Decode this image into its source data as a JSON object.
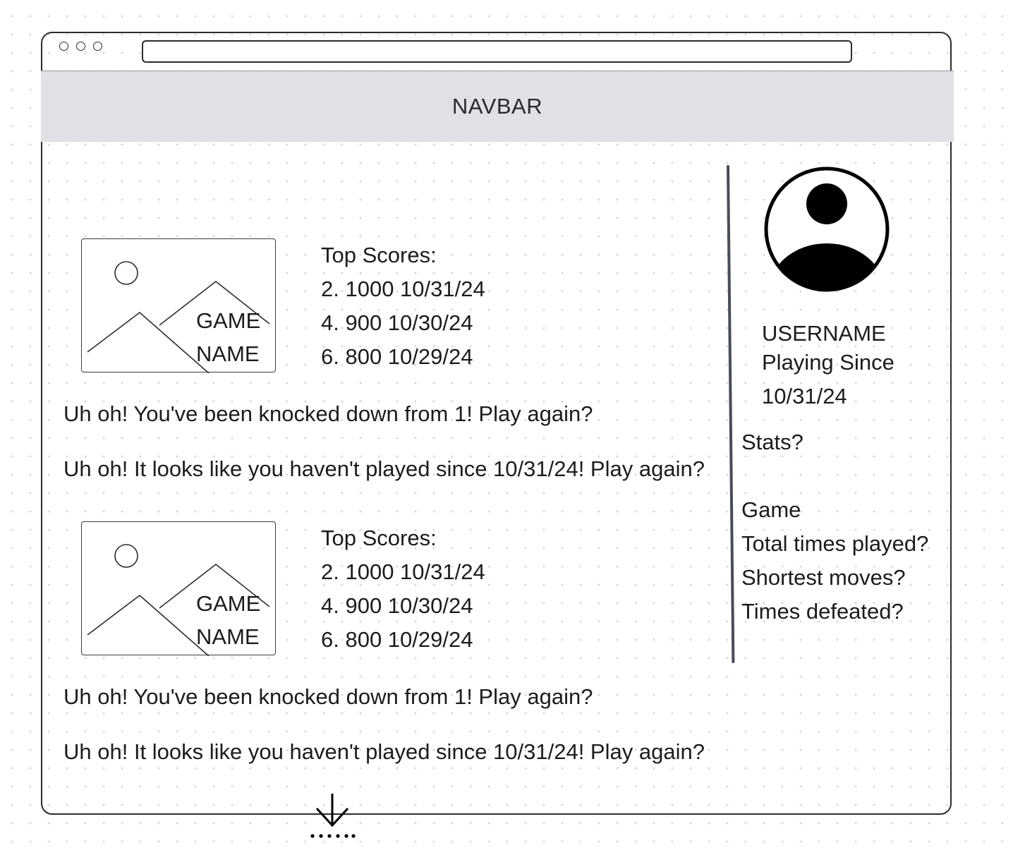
{
  "navbar": {
    "label": "NAVBAR"
  },
  "games": [
    {
      "image_label": [
        "GAME",
        "NAME"
      ],
      "top_scores_label": "Top Scores:",
      "scores": [
        "2. 1000 10/31/24",
        "4. 900 10/30/24",
        "6. 800 10/29/24"
      ],
      "messages": [
        "Uh oh! You've been knocked down from 1! Play again?",
        "Uh oh! It looks like you haven't played since 10/31/24! Play again?"
      ]
    },
    {
      "image_label": [
        "GAME",
        "NAME"
      ],
      "top_scores_label": "Top Scores:",
      "scores": [
        "2. 1000 10/31/24",
        "4. 900 10/30/24",
        "6. 800 10/29/24"
      ],
      "messages": [
        "Uh oh! You've been knocked down from 1! Play again?",
        "Uh oh! It looks like you haven't played since 10/31/24! Play again?"
      ]
    }
  ],
  "profile": {
    "username": "USERNAME",
    "playing_since_label": "Playing Since",
    "playing_since_date": "10/31/24",
    "stats_label": "Stats?",
    "stats_items": [
      "Game",
      "Total times played?",
      "Shortest moves?",
      "Times defeated?"
    ]
  },
  "icons": {
    "window_controls": "window-dots-icon",
    "avatar": "user-avatar-icon",
    "image_placeholder": "image-placeholder-icon",
    "scroll_more": "scroll-down-arrow-icon"
  },
  "colors": {
    "navbar_bg": "#e0e0e5",
    "ink": "#1c1c1e",
    "divider": "#4a4c56"
  }
}
